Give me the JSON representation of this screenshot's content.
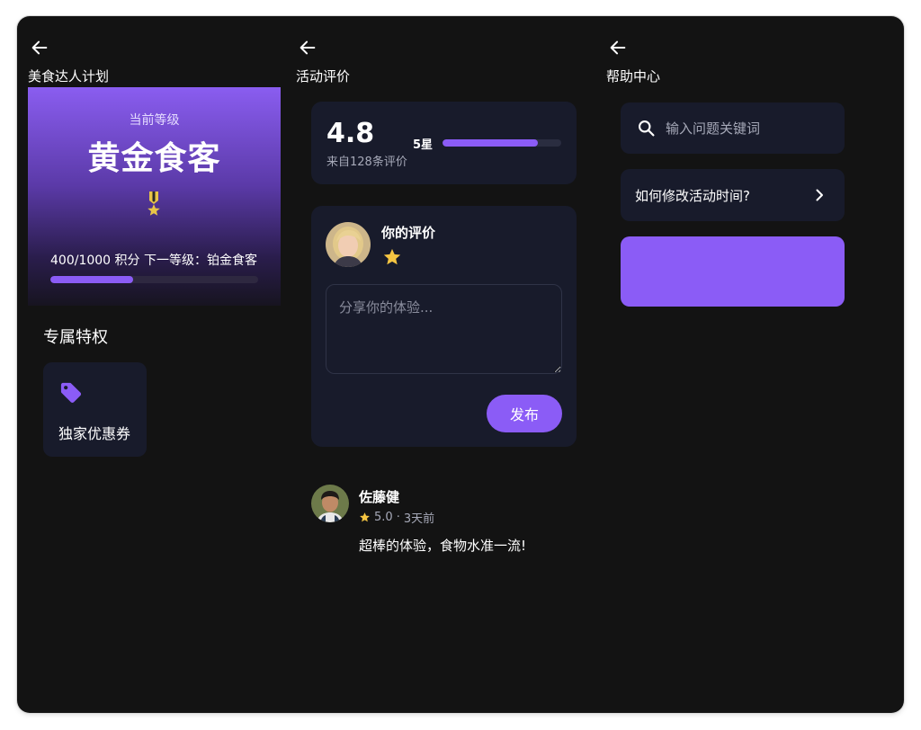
{
  "left_screen": {
    "title": "美食达人计划",
    "level_card": {
      "caption": "当前等级",
      "level_name": "黄金食客",
      "points_text": "400/1000 积分 下一等级：铂金食客",
      "progress_fraction": 0.4
    },
    "section_title": "专属特权",
    "perks": [
      {
        "label": "独家优惠券",
        "icon": "tag-icon"
      }
    ]
  },
  "middle_screen": {
    "title": "活动评价",
    "rating_summary": {
      "score": "4.8",
      "count_text": "来自128条评价",
      "rows": [
        {
          "label": "5星",
          "fraction": 0.8
        }
      ]
    },
    "my_review": {
      "title": "你的评价",
      "placeholder": "分享你的体验...",
      "publish_label": "发布",
      "selected_stars": 1
    },
    "comments": [
      {
        "name": "佐藤健",
        "rating": "5.0",
        "time": "3天前",
        "separator": "·",
        "text": "超棒的体验，食物水准一流!"
      }
    ]
  },
  "right_screen": {
    "title": "帮助中心",
    "search": {
      "placeholder": "输入问题关键词"
    },
    "faq": [
      {
        "question": "如何修改活动时间?"
      }
    ]
  },
  "colors": {
    "background": "#131313",
    "card": "#181b2b",
    "accent": "#8b5cf6",
    "star": "#f5c542",
    "muted_text": "#a6a9b8"
  }
}
